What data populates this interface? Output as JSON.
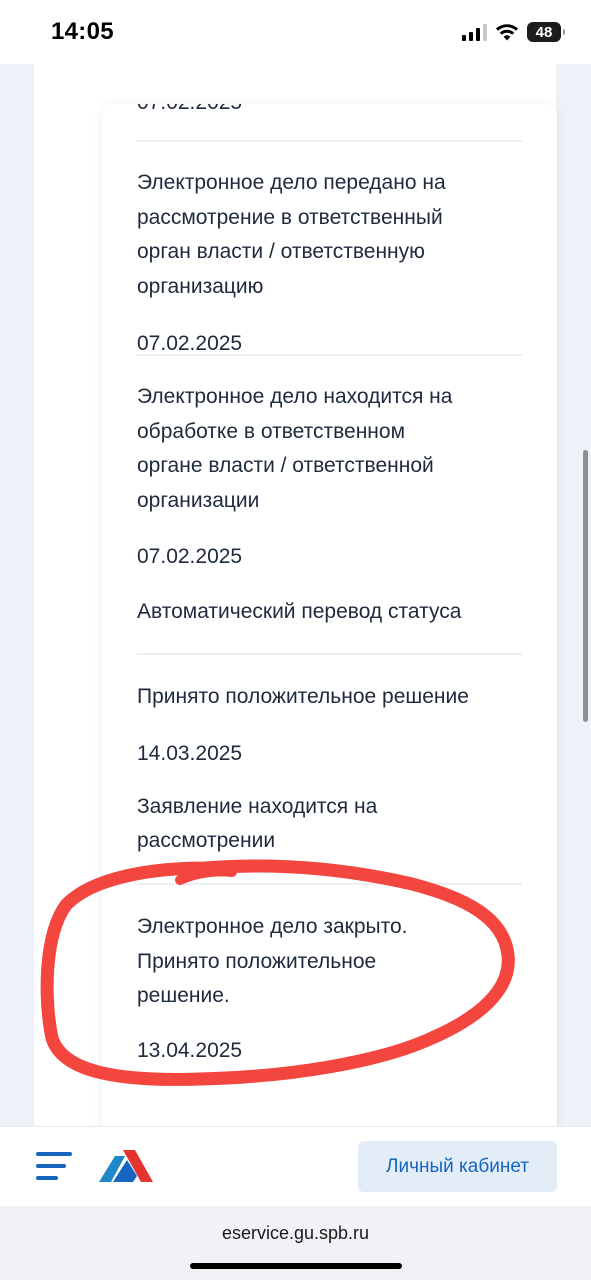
{
  "status_bar": {
    "time": "14:05",
    "battery_level": "48",
    "icons": [
      "cellular-signal-icon",
      "wifi-icon",
      "battery-icon"
    ]
  },
  "history": {
    "partial_top_date": "07.02.2025",
    "entries": [
      {
        "title_lines": [
          "Электронное дело передано на",
          "рассмотрение в ответственный",
          "орган власти / ответственную",
          "организацию"
        ],
        "date": "07.02.2025",
        "note_lines": []
      },
      {
        "title_lines": [
          "Электронное дело находится на",
          "обработке в ответственном",
          "органе власти / ответственной",
          "организации"
        ],
        "date": "07.02.2025",
        "note_lines": [
          "Автоматический перевод статуса"
        ]
      },
      {
        "title_lines": [
          "Принято положительное решение"
        ],
        "date": "14.03.2025",
        "note_lines": [
          "Заявление находится на",
          "рассмотрении"
        ]
      },
      {
        "title_lines": [
          "Электронное дело закрыто.",
          "Принято положительное",
          "решение."
        ],
        "date": "13.04.2025",
        "note_lines": []
      }
    ]
  },
  "bottom_nav": {
    "menu_icon": "hamburger-menu-icon",
    "logo_icon": "portal-logo-icon",
    "account_button_label": "Личный кабинет"
  },
  "browser": {
    "url": "eservice.gu.spb.ru"
  },
  "colors": {
    "accent_blue": "#1665c0",
    "logo_red": "#e3342f",
    "annotation_red": "#f2463f",
    "account_button_bg": "#e3edf8"
  }
}
